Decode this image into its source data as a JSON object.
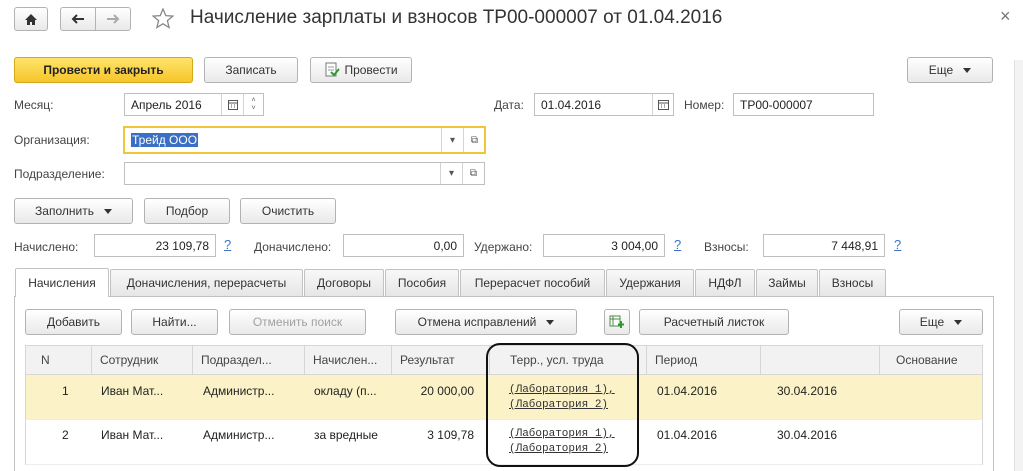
{
  "window": {
    "title": "Начисление зарплаты и взносов ТР00-000007 от 01.04.2016",
    "close_glyph": "×"
  },
  "toolbar": {
    "post_close": "Провести и закрыть",
    "save": "Записать",
    "post": "Провести",
    "more": "Еще"
  },
  "form": {
    "month_label": "Месяц:",
    "month_value": "Апрель 2016",
    "date_label": "Дата:",
    "date_value": "01.04.2016",
    "number_label": "Номер:",
    "number_value": "ТР00-000007",
    "org_label": "Организация:",
    "org_value": "Трейд ООО",
    "dept_label": "Подразделение:",
    "dept_value": ""
  },
  "actions": {
    "fill": "Заполнить",
    "select": "Подбор",
    "clear": "Очистить"
  },
  "totals": {
    "accrued_label": "Начислено:",
    "accrued_value": "23 109,78",
    "extra_label": "Доначислено:",
    "extra_value": "0,00",
    "withheld_label": "Удержано:",
    "withheld_value": "3 004,00",
    "contrib_label": "Взносы:",
    "contrib_value": "7 448,91",
    "help": "?"
  },
  "tabs": [
    "Начисления",
    "Доначисления, перерасчеты",
    "Договоры",
    "Пособия",
    "Перерасчет пособий",
    "Удержания",
    "НДФЛ",
    "Займы",
    "Взносы"
  ],
  "table_toolbar": {
    "add": "Добавить",
    "find": "Найти...",
    "cancel_search": "Отменить поиск",
    "corrections": "Отмена исправлений",
    "payslip": "Расчетный листок",
    "more": "Еще"
  },
  "table": {
    "columns": [
      "N",
      "Сотрудник",
      "Подраздел...",
      "Начислен...",
      "Результат",
      "Терр., усл. труда",
      "Период",
      "",
      "Основание"
    ],
    "rows": [
      {
        "n": "1",
        "employee": "Иван Мат...",
        "dept": "Администр...",
        "accrual": "окладу (п...",
        "result": "20 000,00",
        "terr1": "(Лаборатория 1),",
        "terr2": "(Лаборатория 2)",
        "from": "01.04.2016",
        "to": "30.04.2016"
      },
      {
        "n": "2",
        "employee": "Иван Мат...",
        "dept": "Администр...",
        "accrual": "за вредные",
        "result": "3 109,78",
        "terr1": "(Лаборатория 1),",
        "terr2": "(Лаборатория 2)",
        "from": "01.04.2016",
        "to": "30.04.2016"
      }
    ]
  },
  "colors": {
    "primary_button": "#f6c52a",
    "selected_row": "#fbf3c7",
    "focus_border": "#f0c53a",
    "link": "#3a75c4"
  }
}
